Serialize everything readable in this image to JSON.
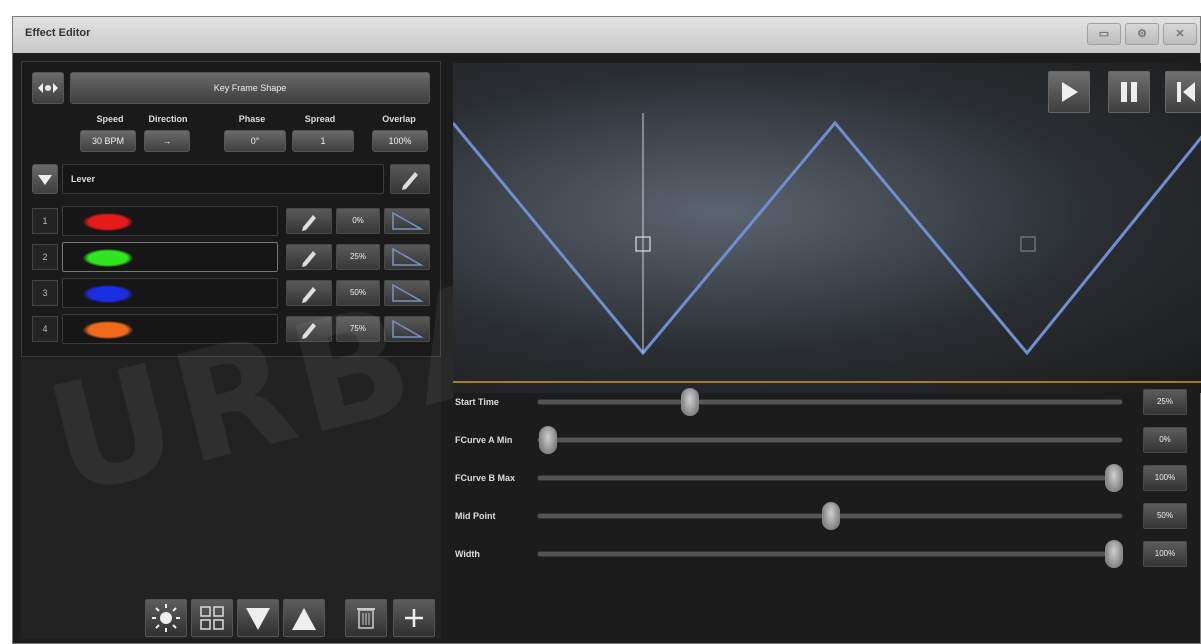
{
  "window": {
    "title": "Effect Editor"
  },
  "key_frame": {
    "label": "Key Frame Shape"
  },
  "params": [
    {
      "label": "Speed",
      "value": "30 BPM"
    },
    {
      "label": "Direction",
      "value": "→"
    },
    {
      "label": "Phase",
      "value": "0°"
    },
    {
      "label": "Spread",
      "value": "1"
    },
    {
      "label": "Overlap",
      "value": "100%"
    }
  ],
  "layer": {
    "name": "Lever"
  },
  "steps": [
    {
      "index": "1",
      "color": "#e41b1b",
      "percent": "0%"
    },
    {
      "index": "2",
      "color": "#2ee51f",
      "percent": "25%"
    },
    {
      "index": "3",
      "color": "#1c2ee3",
      "percent": "50%"
    },
    {
      "index": "4",
      "color": "#f06a1a",
      "percent": "75%"
    }
  ],
  "sliders": [
    {
      "label": "Start Time",
      "value": "25%",
      "level": 0.25
    },
    {
      "label": "FCurve A Min",
      "value": "0%",
      "level": 0.0
    },
    {
      "label": "FCurve B Max",
      "value": "100%",
      "level": 1.0
    },
    {
      "label": "Mid Point",
      "value": "50%",
      "level": 0.5
    },
    {
      "label": "Width",
      "value": "100%",
      "level": 1.0
    }
  ],
  "icons": {
    "expand": "expand-arrows-icon",
    "play": "play-icon",
    "pause": "pause-icon",
    "rewind": "skip-back-icon",
    "pencil": "pencil-icon",
    "ramp": "ramp-icon",
    "brightness": "sun-icon",
    "grid": "grid-icon",
    "move_down": "arrow-down-icon",
    "move_up": "arrow-up-icon",
    "delete": "trash-icon",
    "add": "plus-icon"
  },
  "colors": {
    "waveform": "#6f8fd0",
    "playhead": "#d49626"
  }
}
